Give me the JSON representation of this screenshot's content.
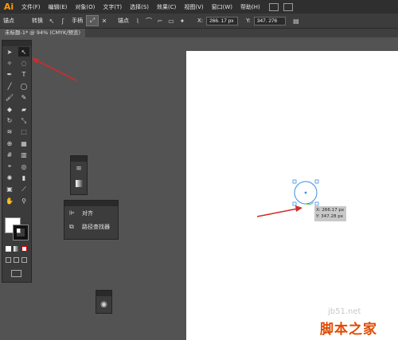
{
  "app": {
    "logo": "Ai"
  },
  "menu": [
    "文件(F)",
    "编辑(E)",
    "对象(O)",
    "文字(T)",
    "选择(S)",
    "效果(C)",
    "视图(V)",
    "窗口(W)",
    "帮助(H)"
  ],
  "control_bar": {
    "left_label": "锚点",
    "convert_label": "转换",
    "handle_label": "手柄",
    "anchor_label": "锚点",
    "x_label": "X:",
    "x_value": "266. 17 px",
    "y_label": "Y:",
    "y_value": "347. 276"
  },
  "document_tab": {
    "label": "未标题-1* @ 94% (CMYK/预览)"
  },
  "panels": {
    "align": {
      "label": "对齐"
    },
    "pathfinder": {
      "label": "路径查找器"
    }
  },
  "tooltip": {
    "x": "X: 266.17 px",
    "y": "Y: 347.28 px"
  },
  "watermark": {
    "site": "jb51.net",
    "name": "脚本之家"
  },
  "colors": {
    "fill": "#ffffff",
    "stroke": "#111111",
    "arrow": "#d42a2a",
    "selection": "#3a8ee6",
    "app_accent": "#ff9a00"
  }
}
